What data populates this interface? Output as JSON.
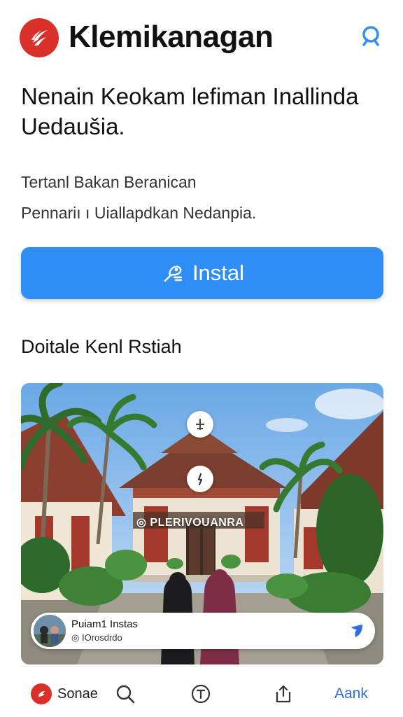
{
  "header": {
    "app_title": "Klemikanagan",
    "search_icon": "search-icon"
  },
  "intro": {
    "headline": "Nenain Keokam lefiman Inallinda Uedaušia.",
    "description_line1": "Tertanl Bakan Beranican",
    "description_line2": "Pennariı ı Uiallapdkan Nedanpia."
  },
  "install_button": {
    "label": "Instal",
    "icon": "install-icon"
  },
  "section": {
    "title": "Doitale Kenl Rstiah"
  },
  "card": {
    "sign_text": "PLERIVOUANRA",
    "place": {
      "title": "Puiam1 Instas",
      "subtitle": "IOrosdrdo"
    }
  },
  "bottom_nav": {
    "home_label": "Sonae",
    "account_label": "Aank"
  },
  "colors": {
    "brand_red": "#d9302a",
    "install_blue": "#2f8ef5",
    "link_blue": "#2f6fd8"
  }
}
